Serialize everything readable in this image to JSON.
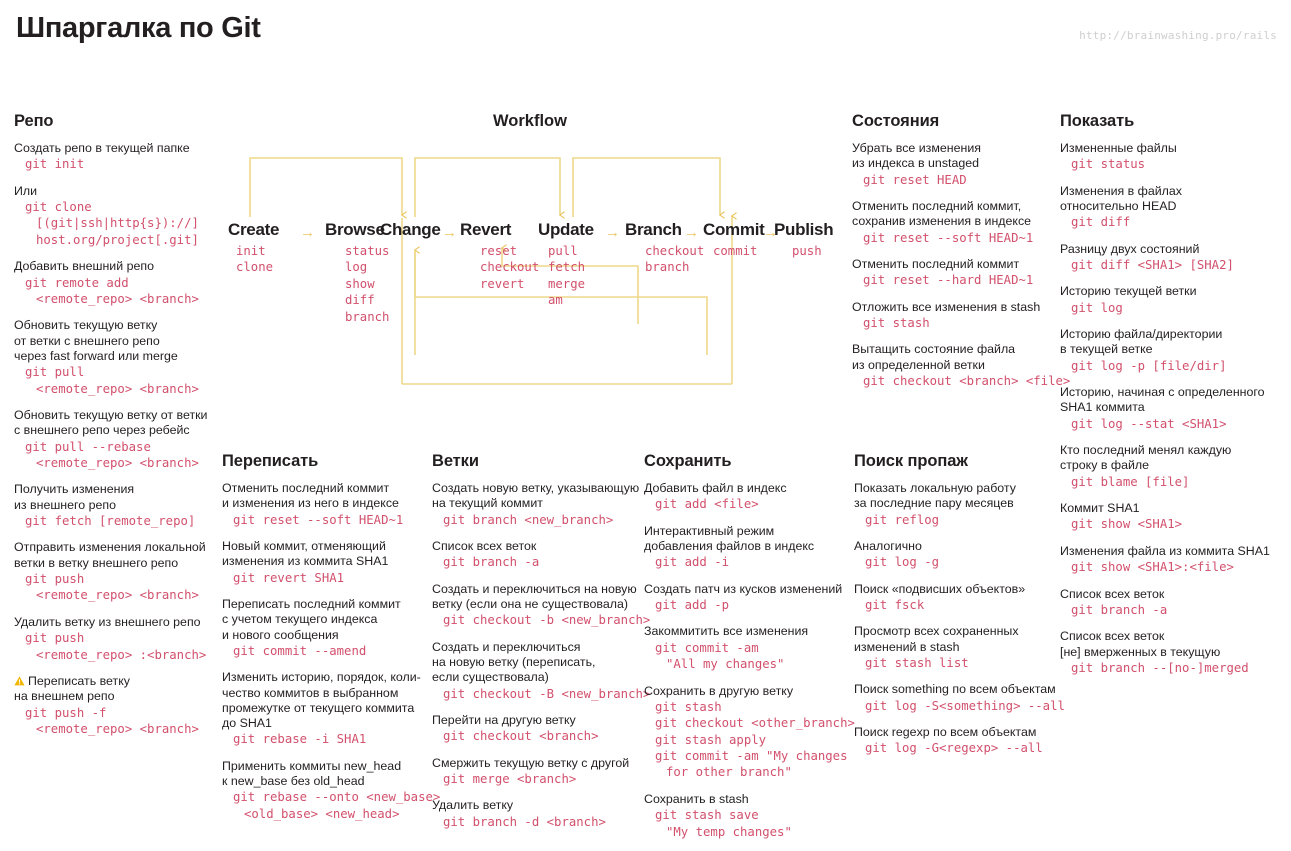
{
  "header": {
    "title": "Шпаргалка по Git",
    "url": "http://brainwashing.pro/rails"
  },
  "colors": {
    "code": "#d2506c",
    "text": "#231f20",
    "accent_line": "#eed98a",
    "arrow": "#eac45c",
    "warn": "#f2b705",
    "url": "#cfcfcf"
  },
  "columns": {
    "repo": {
      "heading": "Репо",
      "blocks": [
        {
          "desc": [
            "Создать репо в текущей папке"
          ],
          "code": [
            "git init"
          ]
        },
        {
          "desc": [
            "Или"
          ],
          "code": [
            "git clone"
          ],
          "code_ind": [
            "[(git|ssh|http{s})://]",
            "host.org/project[.git]"
          ]
        },
        {
          "desc": [
            "Добавить внешний репо"
          ],
          "code": [
            "git remote add"
          ],
          "code_ind": [
            "<remote_repo> <branch>"
          ]
        },
        {
          "desc": [
            "Обновить текущую ветку",
            "от ветки с внешнего репо",
            "через fast forward или merge"
          ],
          "code": [
            "git pull"
          ],
          "code_ind": [
            "<remote_repo> <branch>"
          ]
        },
        {
          "desc": [
            "Обновить текущую ветку от ветки",
            "с внешнего репо через ребейс"
          ],
          "code": [
            "git pull --rebase"
          ],
          "code_ind": [
            "<remote_repo> <branch>"
          ]
        },
        {
          "desc": [
            "Получить изменения",
            "из внешнего репо"
          ],
          "code": [
            "git fetch [remote_repo]"
          ]
        },
        {
          "desc": [
            "Отправить изменения локальной",
            "ветки в ветку внешнего репо"
          ],
          "code": [
            "git push"
          ],
          "code_ind": [
            "<remote_repo> <branch>"
          ]
        },
        {
          "desc": [
            "Удалить ветку из внешнего репо"
          ],
          "code": [
            "git push"
          ],
          "code_ind": [
            "<remote_repo> :<branch>"
          ]
        },
        {
          "warning": true,
          "desc": [
            "Переписать ветку",
            "на внешнем репо"
          ],
          "code": [
            "git push -f"
          ],
          "code_ind": [
            "<remote_repo> <branch>"
          ]
        }
      ]
    },
    "states": {
      "heading": "Состояния",
      "blocks": [
        {
          "desc": [
            "Убрать все изменения",
            "из индекса в unstaged"
          ],
          "code": [
            "git reset HEAD"
          ]
        },
        {
          "desc": [
            "Отменить последний коммит,",
            "сохранив изменения в индексе"
          ],
          "code": [
            "git reset --soft HEAD~1"
          ]
        },
        {
          "desc": [
            "Отменить последний коммит"
          ],
          "code": [
            "git reset --hard HEAD~1"
          ]
        },
        {
          "desc": [
            "Отложить все изменения в stash"
          ],
          "code": [
            "git stash"
          ]
        },
        {
          "desc": [
            "Вытащить состояние файла",
            "из определенной ветки"
          ],
          "code": [
            "git checkout <branch> <file>"
          ]
        }
      ]
    },
    "show": {
      "heading": "Показать",
      "blocks": [
        {
          "desc": [
            "Измененные файлы"
          ],
          "code": [
            "git status"
          ]
        },
        {
          "desc": [
            "Изменения в файлах",
            "относительно HEAD"
          ],
          "code": [
            "git diff"
          ]
        },
        {
          "desc": [
            "Разницу двух состояний"
          ],
          "code": [
            "git diff <SHA1> [SHA2]"
          ]
        },
        {
          "desc": [
            "Историю текущей ветки"
          ],
          "code": [
            "git log"
          ]
        },
        {
          "desc": [
            "Историю файла/директории",
            "в текущей ветке"
          ],
          "code": [
            "git log -p [file/dir]"
          ]
        },
        {
          "desc": [
            "Историю, начиная с определенного",
            "SHA1 коммита"
          ],
          "code": [
            "git log --stat <SHA1>"
          ]
        },
        {
          "desc": [
            "Кто последний менял каждую",
            "строку в файле"
          ],
          "code": [
            "git blame [file]"
          ]
        },
        {
          "desc": [
            "Коммит SHA1"
          ],
          "code": [
            "git show <SHA1>"
          ]
        },
        {
          "desc": [
            "Изменения файла из коммита SHA1"
          ],
          "code": [
            "git show <SHA1>:<file>"
          ]
        },
        {
          "desc": [
            "Список всех веток"
          ],
          "code": [
            "git branch -a"
          ]
        },
        {
          "desc": [
            "Список всех веток",
            "[не] вмерженных в текущую"
          ],
          "code": [
            "git branch --[no-]merged"
          ]
        }
      ]
    },
    "rewrite": {
      "heading": "Переписать",
      "blocks": [
        {
          "desc": [
            "Отменить последний коммит",
            "и изменения из него в индексе"
          ],
          "code": [
            "git reset --soft HEAD~1"
          ]
        },
        {
          "desc": [
            "Новый коммит, отменяющий",
            "изменения из коммита SHA1"
          ],
          "code": [
            "git revert SHA1"
          ]
        },
        {
          "desc": [
            "Переписать последний коммит",
            "с учетом текущего индекса",
            "и нового сообщения"
          ],
          "code": [
            "git commit --amend"
          ]
        },
        {
          "desc": [
            "Изменить историю, порядок, коли-",
            "чество коммитов в выбранном",
            "промежутке от текущего коммита",
            "до SHA1"
          ],
          "code": [
            "git rebase -i SHA1"
          ]
        },
        {
          "desc": [
            "Применить коммиты new_head",
            "к new_base без old_head"
          ],
          "code": [
            "git rebase --onto <new_base>"
          ],
          "code_ind": [
            "<old_base> <new_head>"
          ]
        }
      ]
    },
    "branches": {
      "heading": "Ветки",
      "blocks": [
        {
          "desc": [
            "Создать новую ветку, указывающую",
            "на текущий коммит"
          ],
          "code": [
            "git branch <new_branch>"
          ]
        },
        {
          "desc": [
            "Список всех веток"
          ],
          "code": [
            "git branch -a"
          ]
        },
        {
          "desc": [
            "Создать и переключиться на новую",
            "ветку (если она не существовала)"
          ],
          "code": [
            "git checkout -b <new_branch>"
          ]
        },
        {
          "desc": [
            "Создать и переключиться",
            "на новую ветку (переписать,",
            "если существовала)"
          ],
          "code": [
            "git checkout -B <new_branch>"
          ]
        },
        {
          "desc": [
            "Перейти на другую ветку"
          ],
          "code": [
            "git checkout <branch>"
          ]
        },
        {
          "desc": [
            "Смержить текущую ветку с другой"
          ],
          "code": [
            "git merge <branch>"
          ]
        },
        {
          "desc": [
            "Удалить ветку"
          ],
          "code": [
            "git branch -d <branch>"
          ]
        }
      ]
    },
    "save": {
      "heading": "Сохранить",
      "blocks": [
        {
          "desc": [
            "Добавить файл в индекс"
          ],
          "code": [
            "git add <file>"
          ]
        },
        {
          "desc": [
            "Интерактивный режим",
            "добавления файлов в индекс"
          ],
          "code": [
            "git add -i"
          ]
        },
        {
          "desc": [
            "Создать патч из кусков изменений"
          ],
          "code": [
            "git add -p"
          ]
        },
        {
          "desc": [
            "Закоммитить все изменения"
          ],
          "code": [
            "git commit -am"
          ],
          "code_ind": [
            "\"All my changes\""
          ]
        },
        {
          "desc": [
            "Сохранить в другую ветку"
          ],
          "code": [
            "git stash",
            "git checkout <other_branch>",
            "git stash apply",
            "git commit -am \"My changes"
          ],
          "code_ind": [
            "for other branch\""
          ]
        },
        {
          "desc": [
            "Сохранить в stash"
          ],
          "code": [
            "git stash save"
          ],
          "code_ind": [
            "\"My temp changes\""
          ]
        }
      ]
    },
    "lost": {
      "heading": "Поиск пропаж",
      "blocks": [
        {
          "desc": [
            "Показать локальную работу",
            "за последние пару месяцев"
          ],
          "code": [
            "git reflog"
          ]
        },
        {
          "desc": [
            "Аналогично"
          ],
          "code": [
            "git log -g"
          ]
        },
        {
          "desc": [
            "Поиск «подвисших объектов»"
          ],
          "code": [
            "git fsck"
          ]
        },
        {
          "desc": [
            "Просмотр всех сохраненных",
            "изменений в stash"
          ],
          "code": [
            "git stash list"
          ]
        },
        {
          "desc": [
            "Поиск something по всем объектам"
          ],
          "code": [
            "git log -S<something> --all"
          ]
        },
        {
          "desc": [
            "Поиск regexp по всем объектам"
          ],
          "code": [
            "git log -G<regexp> --all"
          ]
        }
      ]
    }
  },
  "workflow": {
    "title": "Workflow",
    "nodes": [
      {
        "name": "Create",
        "cmds": [
          "init",
          "clone"
        ]
      },
      {
        "name": "Browse",
        "cmds": [
          "status",
          "log",
          "show",
          "diff",
          "branch"
        ]
      },
      {
        "name": "Change",
        "cmds": []
      },
      {
        "name": "Revert",
        "cmds": [
          "reset",
          "checkout",
          "revert"
        ]
      },
      {
        "name": "Update",
        "cmds": [
          "pull",
          "fetch",
          "merge",
          "am"
        ]
      },
      {
        "name": "Branch",
        "cmds": [
          "checkout",
          "branch"
        ]
      },
      {
        "name": "Commit",
        "cmds": [
          "commit"
        ]
      },
      {
        "name": "Publish",
        "cmds": [
          "push"
        ]
      }
    ],
    "arrows": [
      "→",
      "→",
      "→",
      "→",
      "→",
      "→"
    ]
  }
}
